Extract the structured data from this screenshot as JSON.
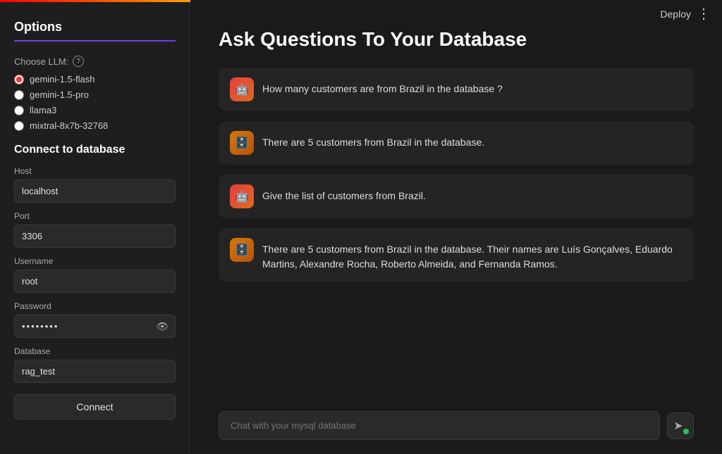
{
  "rainbow": true,
  "topbar": {
    "deploy_label": "Deploy",
    "menu_icon": "⋮"
  },
  "sidebar": {
    "options_title": "Options",
    "choose_llm_label": "Choose LLM:",
    "llm_options": [
      {
        "value": "gemini-1.5-flash",
        "label": "gemini-1.5-flash",
        "selected": true
      },
      {
        "value": "gemini-1.5-pro",
        "label": "gemini-1.5-pro",
        "selected": false
      },
      {
        "value": "llama3",
        "label": "llama3",
        "selected": false
      },
      {
        "value": "mixtral-8x7b-32768",
        "label": "mixtral-8x7b-32768",
        "selected": false
      }
    ],
    "connect_title": "Connect to database",
    "fields": {
      "host_label": "Host",
      "host_value": "localhost",
      "port_label": "Port",
      "port_value": "3306",
      "username_label": "Username",
      "username_value": "root",
      "password_label": "Password",
      "password_value": "•••••••",
      "database_label": "Database",
      "database_value": "rag_test"
    },
    "connect_button": "Connect"
  },
  "main": {
    "heading": "Ask Questions To Your Database",
    "messages": [
      {
        "type": "user",
        "text": "How many customers are from Brazil in the database ?"
      },
      {
        "type": "bot",
        "text": "There are 5 customers from Brazil in the database."
      },
      {
        "type": "user",
        "text": "Give the list of customers from Brazil."
      },
      {
        "type": "bot",
        "text": "There are 5 customers from Brazil in the database. Their names are Luís Gonçalves, Eduardo Martins, Alexandre Rocha, Roberto Almeida, and Fernanda Ramos."
      }
    ],
    "chat_placeholder": "Chat with your mysql database",
    "send_icon": "➤"
  }
}
